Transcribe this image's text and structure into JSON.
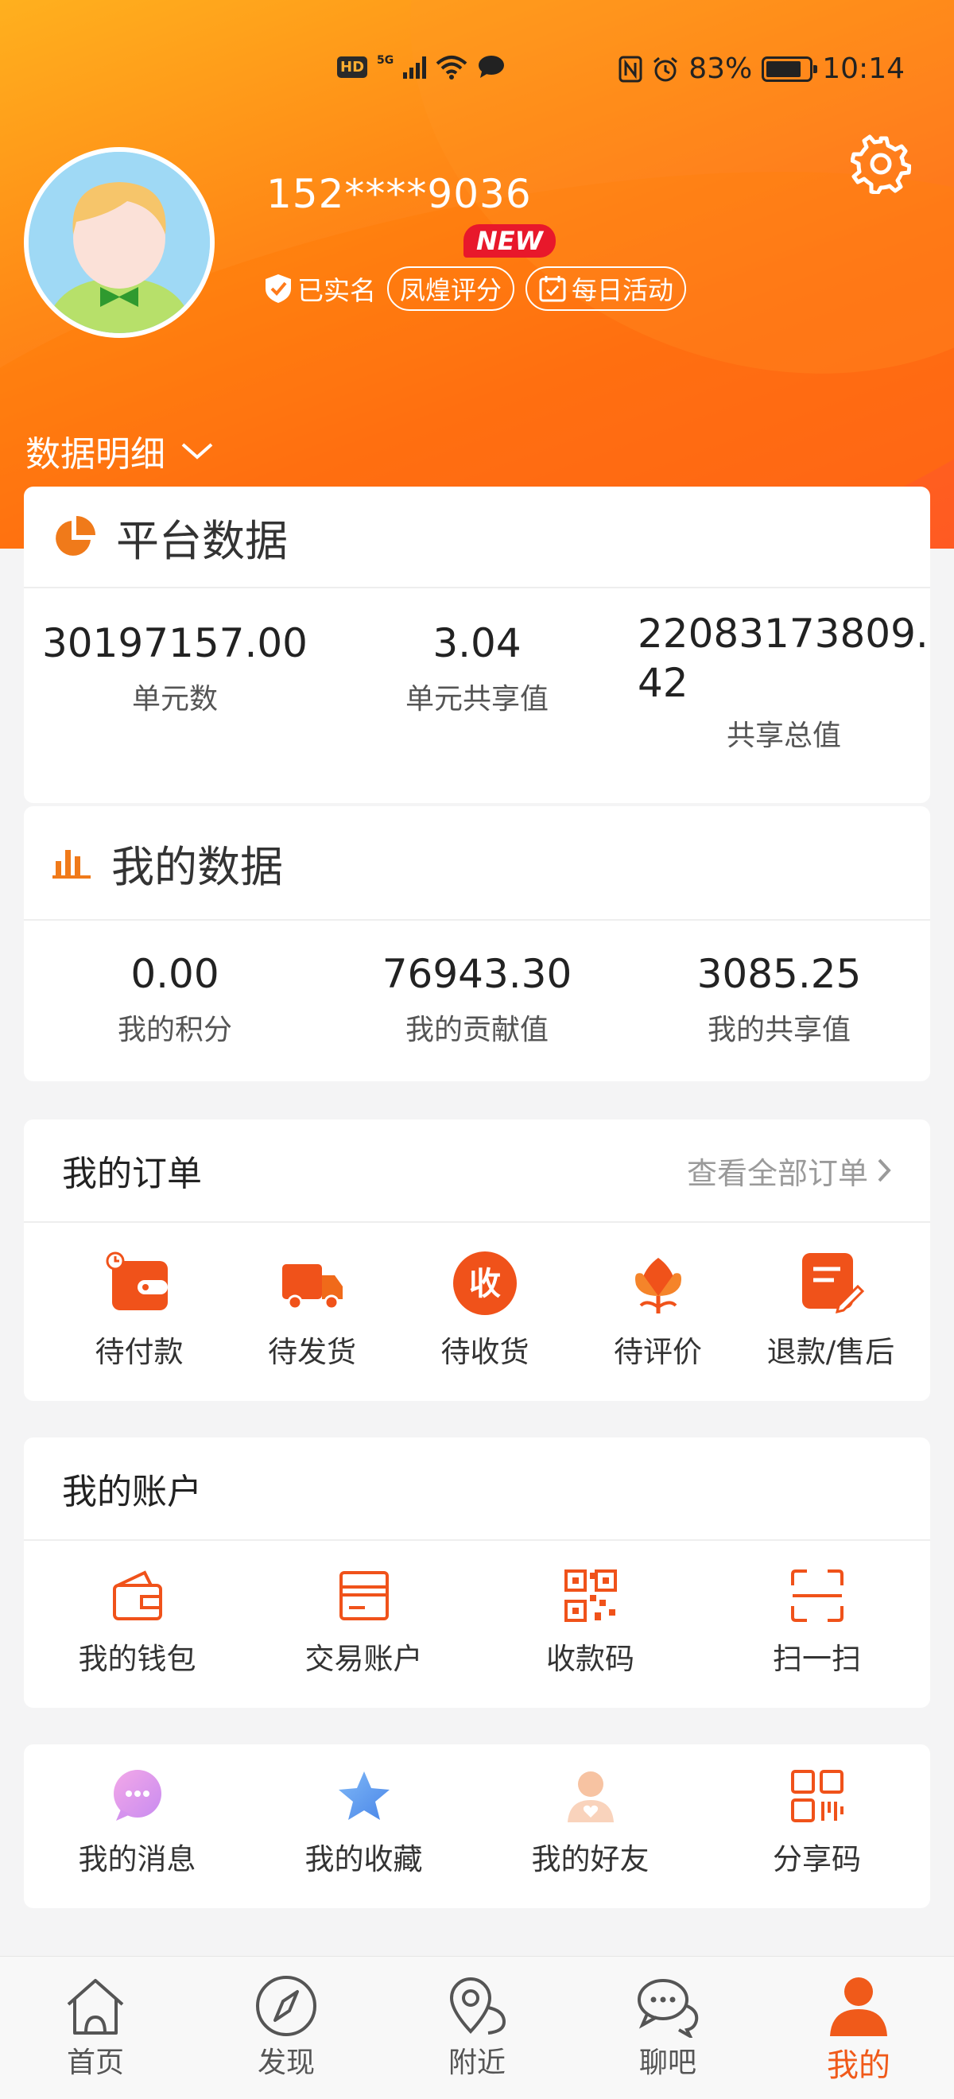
{
  "status_bar": {
    "hd": "HD",
    "net": "5G",
    "battery": "83%",
    "battery_level": 0.83,
    "time": "10:14"
  },
  "profile": {
    "phone": "152****9036",
    "verified_label": "已实名",
    "score_label": "凤煌评分",
    "new_badge": "NEW",
    "daily_label": "每日活动",
    "data_detail_label": "数据明细"
  },
  "platform": {
    "title": "平台数据",
    "stats": [
      {
        "value": "30197157.00",
        "label": "单元数"
      },
      {
        "value": "3.04",
        "label": "单元共享值"
      },
      {
        "value": "22083173809.\n42",
        "label": "共享总值"
      }
    ]
  },
  "mine": {
    "title": "我的数据",
    "stats": [
      {
        "value": "0.00",
        "label": "我的积分"
      },
      {
        "value": "76943.30",
        "label": "我的贡献值"
      },
      {
        "value": "3085.25",
        "label": "我的共享值"
      }
    ]
  },
  "orders": {
    "title": "我的订单",
    "view_all": "查看全部订单",
    "items": [
      {
        "label": "待付款",
        "icon": "wallet-clock-icon"
      },
      {
        "label": "待发货",
        "icon": "truck-icon"
      },
      {
        "label": "待收货",
        "icon": "receive-icon",
        "glyph": "收"
      },
      {
        "label": "待评价",
        "icon": "flower-icon"
      },
      {
        "label": "退款/售后",
        "icon": "note-edit-icon"
      }
    ]
  },
  "account": {
    "title": "我的账户",
    "items": [
      {
        "label": "我的钱包",
        "icon": "wallet-icon"
      },
      {
        "label": "交易账户",
        "icon": "card-icon"
      },
      {
        "label": "收款码",
        "icon": "qr-icon"
      },
      {
        "label": "扫一扫",
        "icon": "scan-icon"
      }
    ]
  },
  "social": {
    "items": [
      {
        "label": "我的消息",
        "icon": "message-icon"
      },
      {
        "label": "我的收藏",
        "icon": "star-icon"
      },
      {
        "label": "我的好友",
        "icon": "friend-icon"
      },
      {
        "label": "分享码",
        "icon": "share-code-icon"
      }
    ]
  },
  "tabbar": {
    "items": [
      {
        "label": "首页",
        "icon": "home-icon"
      },
      {
        "label": "发现",
        "icon": "compass-icon"
      },
      {
        "label": "附近",
        "icon": "location-icon"
      },
      {
        "label": "聊吧",
        "icon": "chat-icon"
      },
      {
        "label": "我的",
        "icon": "profile-icon",
        "active": true
      }
    ]
  },
  "colors": {
    "accent": "#f05a1a",
    "hero_start": "#ffb01e",
    "hero_end": "#ff5a22",
    "new_badge": "#e8182b"
  }
}
